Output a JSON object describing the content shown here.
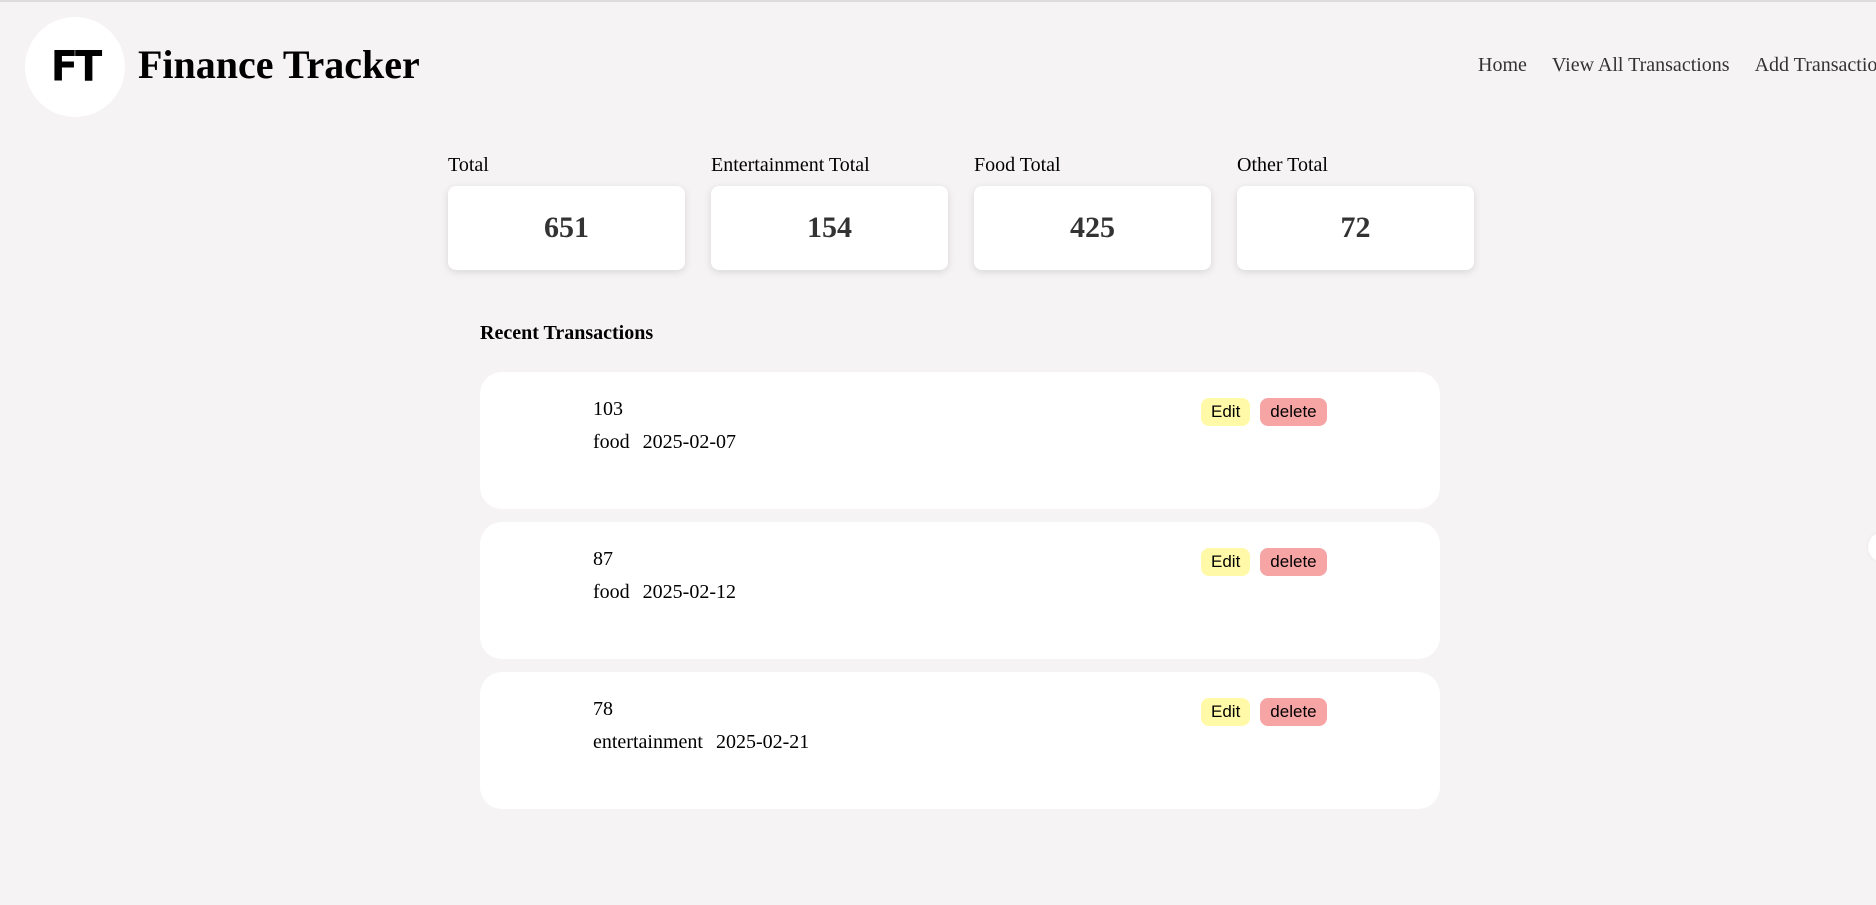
{
  "header": {
    "logo_text": "FT",
    "title": "Finance Tracker",
    "nav": [
      "Home",
      "View All Transactions",
      "Add Transaction"
    ]
  },
  "stats": [
    {
      "label": "Total",
      "value": "651"
    },
    {
      "label": "Entertainment Total",
      "value": "154"
    },
    {
      "label": "Food Total",
      "value": "425"
    },
    {
      "label": "Other Total",
      "value": "72"
    }
  ],
  "recent": {
    "title": "Recent Transactions",
    "edit_label": "Edit",
    "delete_label": "delete",
    "transactions": [
      {
        "amount": "103",
        "category": "food",
        "date": "2025-02-07"
      },
      {
        "amount": "87",
        "category": "food",
        "date": "2025-02-12"
      },
      {
        "amount": "78",
        "category": "entertainment",
        "date": "2025-02-21"
      }
    ]
  },
  "colors": {
    "background": "#f5f3f4",
    "edit_button": "#fff9a8",
    "delete_button": "#f7a4a4"
  }
}
